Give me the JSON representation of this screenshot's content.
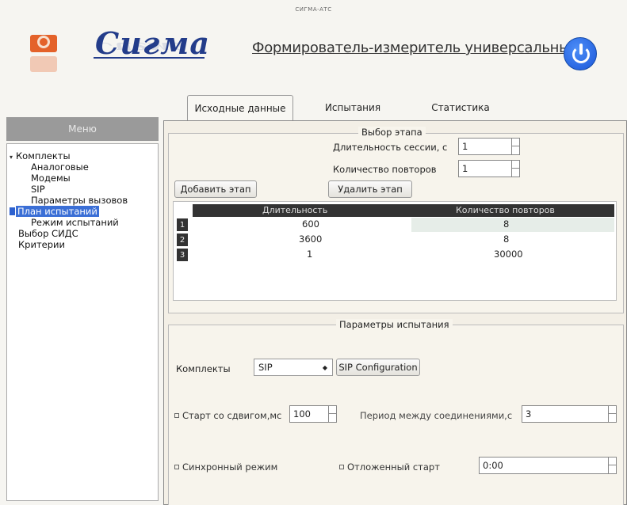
{
  "window": {
    "title": "СИГМА-АТС"
  },
  "header": {
    "brand": "Сигма",
    "subtitle": "Формирователь-измеритель универсальный",
    "icon": "sigma-logo-icon",
    "power_icon": "power-icon"
  },
  "tabs": [
    {
      "label": "Исходные данные",
      "active": true
    },
    {
      "label": "Испытания",
      "active": false
    },
    {
      "label": "Статистика",
      "active": false
    }
  ],
  "sidebar": {
    "title": "Меню",
    "items": [
      {
        "label": "Комплекты",
        "expanded": true
      },
      {
        "label": "Аналоговые"
      },
      {
        "label": "Модемы"
      },
      {
        "label": "SIP"
      },
      {
        "label": "Параметры вызовов"
      },
      {
        "label": "План испытаний",
        "selected": true
      },
      {
        "label": "Режим испытаний"
      },
      {
        "label": "Выбор СИДС"
      },
      {
        "label": "Критерии"
      }
    ]
  },
  "stage": {
    "group_title": "Выбор этапа",
    "session_label": "Длительность сессии, с",
    "session_value": "1",
    "repeats_label": "Количество повторов",
    "repeats_value": "1",
    "add_button": "Добавить этап",
    "remove_button": "Удалить этап",
    "table": {
      "columns": [
        "Длительность",
        "Количество повторов"
      ],
      "rows": [
        {
          "num": "1",
          "duration": "600",
          "repeats": "8"
        },
        {
          "num": "2",
          "duration": "3600",
          "repeats": "8"
        },
        {
          "num": "3",
          "duration": "1",
          "repeats": "30000"
        }
      ]
    }
  },
  "params": {
    "group_title": "Параметры испытания",
    "kits_label": "Комплекты",
    "kits_value": "SIP",
    "sip_config_button": "SIP Configuration",
    "shift_label": "Старт со сдвигом,мс",
    "shift_value": "100",
    "period_label": "Период между соединениями,с",
    "period_value": "3",
    "sync_label": "Синхронный режим",
    "delayed_label": "Отложенный старт",
    "delayed_value": "0:00"
  },
  "colors": {
    "accent": "#233c8a",
    "power": "#1a56d9",
    "logo": "#e4622a",
    "selection": "#3b6fd6"
  }
}
